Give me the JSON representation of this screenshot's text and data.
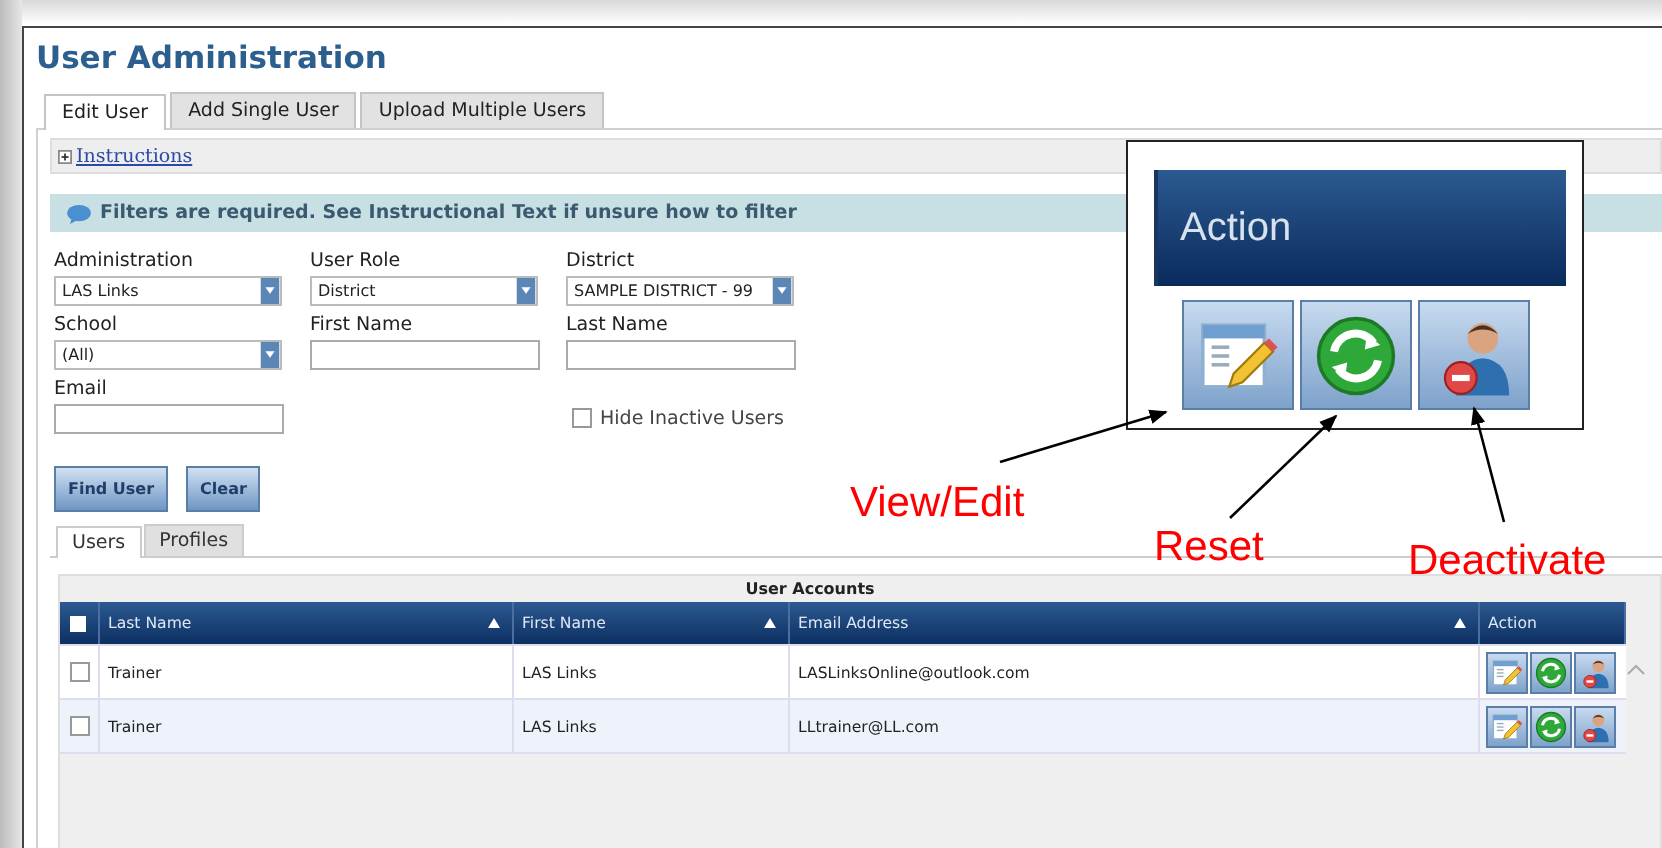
{
  "page_title": "User Administration",
  "tabs": [
    {
      "label": "Edit User",
      "selected": true
    },
    {
      "label": "Add Single User",
      "selected": false
    },
    {
      "label": "Upload Multiple Users",
      "selected": false
    }
  ],
  "instructions": {
    "label": "Instructions",
    "expanded": false
  },
  "notice": "Filters are required. See Instructional Text if unsure how to filter",
  "filters": [
    {
      "kind": "select",
      "label": "Administration",
      "value": "LAS Links"
    },
    {
      "kind": "select",
      "label": "User Role",
      "value": "District"
    },
    {
      "kind": "select",
      "label": "District",
      "value": "SAMPLE DISTRICT - 99"
    },
    {
      "kind": "select",
      "label": "School",
      "value": "(All)"
    },
    {
      "kind": "text",
      "label": "First Name"
    },
    {
      "kind": "text",
      "label": "Last Name"
    },
    {
      "kind": "text",
      "label": "Email"
    },
    {
      "kind": "checkbox",
      "label": "Hide Inactive Users",
      "checked": false
    }
  ],
  "buttons": [
    "Find User",
    "Clear"
  ],
  "subtabs": [
    {
      "label": "Users",
      "selected": true
    },
    {
      "label": "Profiles",
      "selected": false
    }
  ],
  "grid": {
    "caption": "User Accounts",
    "all_checked": false,
    "columns": [
      "Last Name",
      "First Name",
      "Email Address",
      "Action"
    ],
    "rows": [
      {
        "checked": false,
        "cells": [
          "Trainer",
          "LAS Links",
          "LASLinksOnline@outlook.com"
        ]
      },
      {
        "checked": false,
        "cells": [
          "Trainer",
          "LAS Links",
          "LLtrainer@LL.com"
        ]
      }
    ]
  },
  "callout": {
    "header": "Action",
    "labels": [
      "View/Edit",
      "Reset",
      "Deactivate"
    ]
  }
}
